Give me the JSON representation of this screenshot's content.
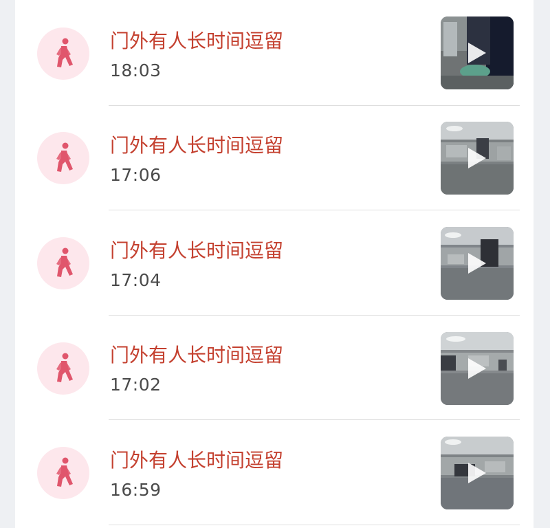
{
  "colors": {
    "title": "#c4402f",
    "time": "#4a4a4a",
    "icon_bg": "#fde7ec",
    "icon_fg": "#e0566c"
  },
  "events": [
    {
      "title": "门外有人长时间逗留",
      "time": "18:03",
      "icon": "walking-person-icon",
      "thumbnail": "video-thumbnail"
    },
    {
      "title": "门外有人长时间逗留",
      "time": "17:06",
      "icon": "walking-person-icon",
      "thumbnail": "video-thumbnail"
    },
    {
      "title": "门外有人长时间逗留",
      "time": "17:04",
      "icon": "walking-person-icon",
      "thumbnail": "video-thumbnail"
    },
    {
      "title": "门外有人长时间逗留",
      "time": "17:02",
      "icon": "walking-person-icon",
      "thumbnail": "video-thumbnail"
    },
    {
      "title": "门外有人长时间逗留",
      "time": "16:59",
      "icon": "walking-person-icon",
      "thumbnail": "video-thumbnail"
    }
  ]
}
